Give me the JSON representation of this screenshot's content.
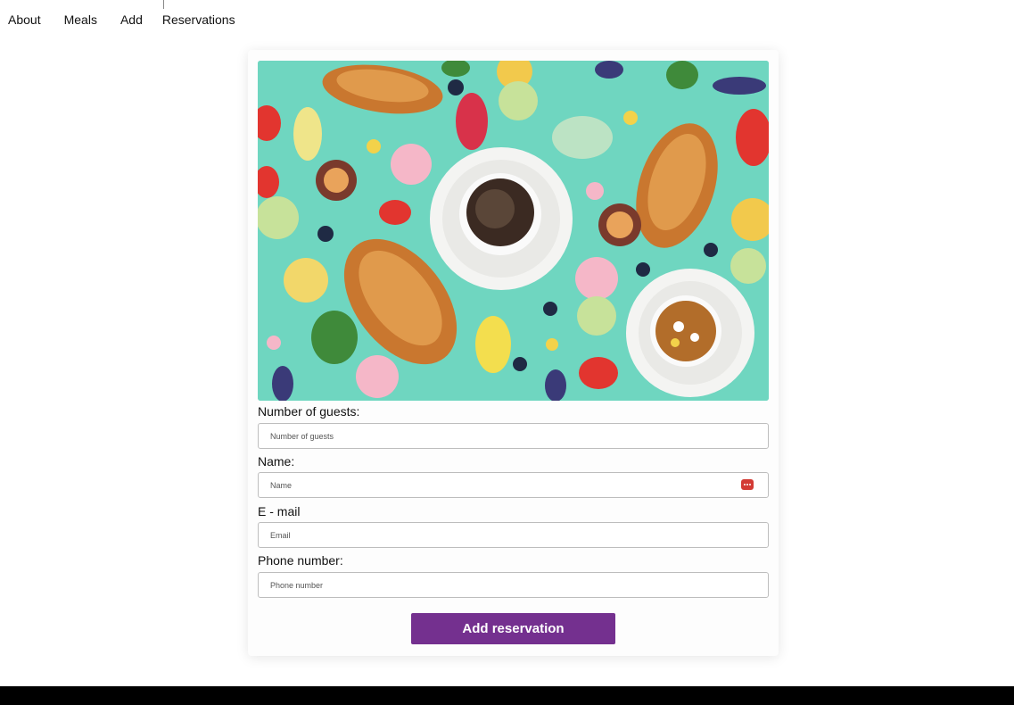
{
  "nav": {
    "items": [
      {
        "label": "About"
      },
      {
        "label": "Meals"
      },
      {
        "label": "Add"
      },
      {
        "label": "Reservations"
      }
    ]
  },
  "form": {
    "guests": {
      "label": "Number of guests:",
      "placeholder": "Number of guests"
    },
    "name": {
      "label": "Name:",
      "placeholder": "Name"
    },
    "email": {
      "label": "E - mail",
      "placeholder": "Email"
    },
    "phone": {
      "label": "Phone number:",
      "placeholder": "Phone number"
    },
    "submit_label": "Add reservation"
  },
  "hero": {
    "icon": "breakfast-photo-icon",
    "background_color": "#6fd6c0"
  },
  "colors": {
    "accent": "#74308f",
    "password_manager": "#d33b35",
    "footer": "#000000"
  }
}
